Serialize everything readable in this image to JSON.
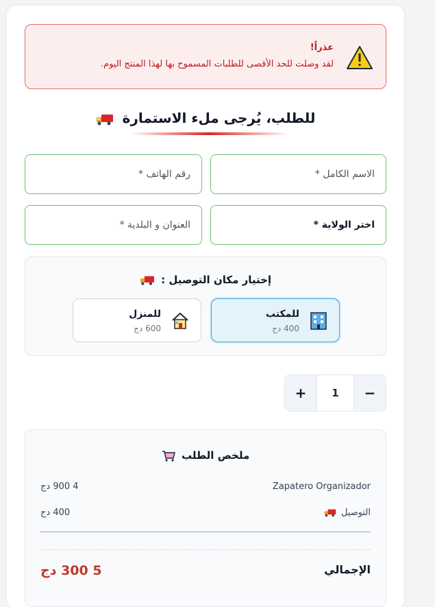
{
  "alert": {
    "title": "عذراً!",
    "message": "لقد وصلت للحد الأقصى للطلبات المسموح بها لهذا المنتج اليوم.",
    "icon": "warning-icon"
  },
  "form": {
    "heading": "للطلب، يُرجى ملء الاستمارة",
    "heading_icon": "truck-icon",
    "fields": {
      "full_name": "الاسم الكامل *",
      "phone": "رقم الهاتف *",
      "wilaya": "اختر الولاية *",
      "address": "العنوان و البلدية *"
    }
  },
  "delivery": {
    "title": "إختيار مكان التوصيل :",
    "options": [
      {
        "label": "للمكتب",
        "price": "400 دج",
        "icon": "office-building-icon",
        "selected": true
      },
      {
        "label": "للمنزل",
        "price": "600 دج",
        "icon": "house-icon",
        "selected": false
      }
    ]
  },
  "quantity": {
    "decrement": "−",
    "value": "1",
    "increment": "+"
  },
  "summary": {
    "title": "ملخص الطلب",
    "title_icon": "shopping-cart-icon",
    "product_name": "Zapatero Organizador",
    "product_price": "4 900 دج",
    "delivery_label": "التوصيل",
    "delivery_icon": "truck-icon",
    "delivery_price": "400 دج",
    "total_label": "الإجمالي",
    "total_value": "5 300 دج"
  },
  "colors": {
    "alert_border": "#e06b6b",
    "alert_bg": "#fdeeee",
    "field_border": "#6cc070",
    "selected_border": "#38a5d8",
    "total_color": "#c0392b"
  }
}
